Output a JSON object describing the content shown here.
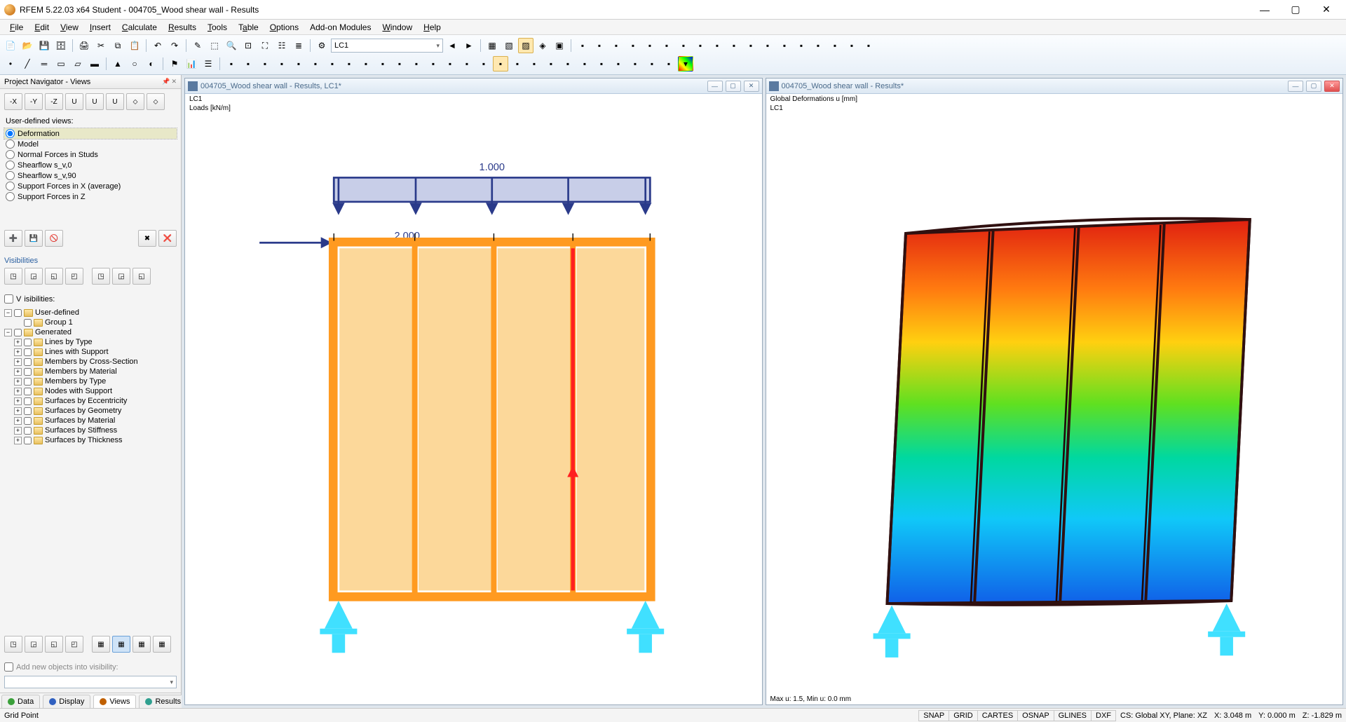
{
  "app": {
    "title": "RFEM 5.22.03 x64 Student - 004705_Wood shear wall - Results"
  },
  "menu": {
    "file": "File",
    "edit": "Edit",
    "view": "View",
    "insert": "Insert",
    "calculate": "Calculate",
    "results": "Results",
    "tools": "Tools",
    "table": "Table",
    "options": "Options",
    "addons": "Add-on Modules",
    "window": "Window",
    "help": "Help"
  },
  "toolbar": {
    "load_case": "LC1"
  },
  "navigator": {
    "title": "Project Navigator - Views",
    "section_userviews": "User-defined views:",
    "views": [
      "Deformation",
      "Model",
      "Normal Forces in Studs",
      "Shearflow s_v,0",
      "Shearflow s_v,90",
      "Support Forces in X (average)",
      "Support Forces in Z"
    ],
    "section_visibilities": "Visibilities",
    "vis_checkbox": "Visibilities:",
    "tree": {
      "user_defined": "User-defined",
      "group1": "Group 1",
      "generated": "Generated",
      "gen_items": [
        "Lines by Type",
        "Lines with Support",
        "Members by Cross-Section",
        "Members by Material",
        "Members by Type",
        "Nodes with Support",
        "Surfaces by Eccentricity",
        "Surfaces by Geometry",
        "Surfaces by Material",
        "Surfaces by Stiffness",
        "Surfaces by Thickness"
      ]
    },
    "add_new": "Add new objects into visibility:",
    "tabs": {
      "data": "Data",
      "display": "Display",
      "views": "Views",
      "results": "Results"
    }
  },
  "viewport_left": {
    "title": "004705_Wood shear wall - Results, LC1*",
    "lc_label": "LC1",
    "loads_label": "Loads [kN/m]",
    "load_top": "1.000",
    "load_side": "2.000"
  },
  "viewport_right": {
    "title": "004705_Wood shear wall - Results*",
    "header1": "Global Deformations u [mm]",
    "header2": "LC1",
    "footer": "Max u: 1.5, Min u: 0.0 mm"
  },
  "status": {
    "left": "Grid Point",
    "toggles": [
      "SNAP",
      "GRID",
      "CARTES",
      "OSNAP",
      "GLINES",
      "DXF"
    ],
    "cs": "CS: Global XY, Plane: XZ",
    "x": "X: 3.048 m",
    "y": "Y: 0.000 m",
    "z": "Z: -1.829 m"
  }
}
